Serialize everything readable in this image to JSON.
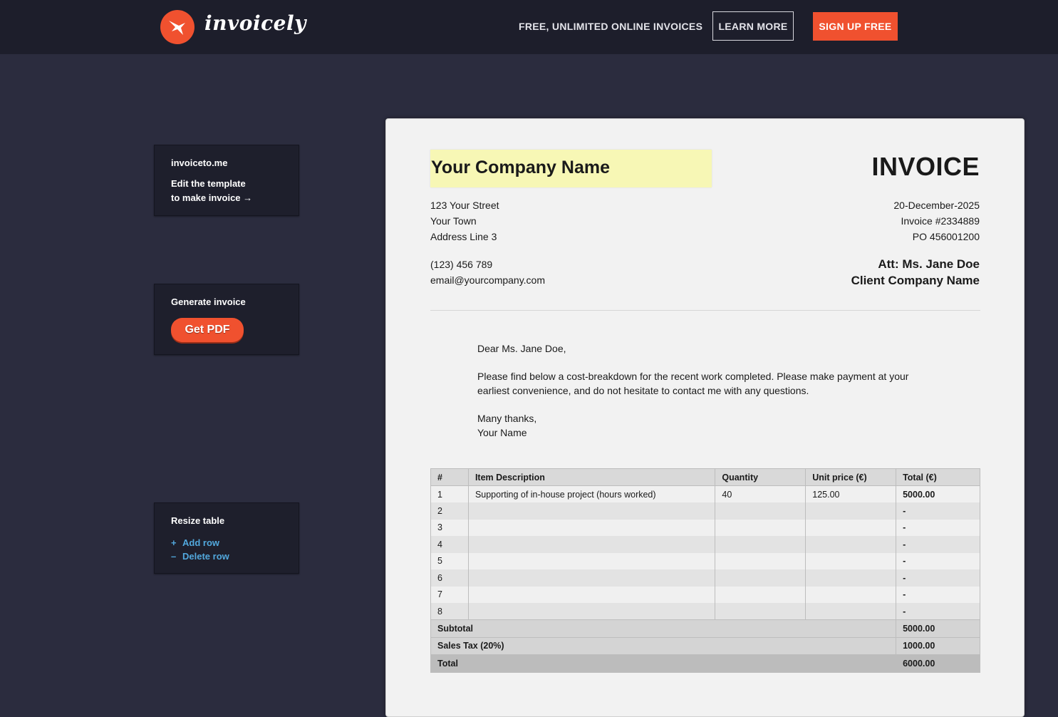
{
  "header": {
    "logo_text": "invoicely",
    "promo": "FREE, UNLIMITED ONLINE INVOICES",
    "learn_more": "LEARN MORE",
    "sign_up": "SIGN UP FREE",
    "accent_color": "#f0512f"
  },
  "sidebar": {
    "card1": {
      "brand": "invoiceto.me",
      "line1": "Edit the template",
      "line2": "to make invoice →"
    },
    "card2": {
      "title": "Generate invoice",
      "button": "Get PDF"
    },
    "card3": {
      "title": "Resize table",
      "add": "Add row",
      "add_sym": "+",
      "delete": "Delete row",
      "delete_sym": "–"
    }
  },
  "invoice": {
    "company_name": "Your Company Name",
    "title": "INVOICE",
    "address": [
      "123 Your Street",
      "Your Town",
      "Address Line 3"
    ],
    "phone": "(123) 456 789",
    "email": "email@yourcompany.com",
    "date": "20-December-2025",
    "number": "Invoice #2334889",
    "po": "PO 456001200",
    "attention": "Att: Ms. Jane Doe",
    "client": "Client Company Name",
    "letter": {
      "greeting": "Dear Ms. Jane Doe,",
      "body": "Please find below a cost-breakdown for the recent work completed. Please make payment at your earliest convenience, and do not hesitate to contact me with any questions.",
      "closing": "Many thanks,",
      "signature": "Your Name"
    },
    "table": {
      "headers": [
        "#",
        "Item Description",
        "Quantity",
        "Unit price (€)",
        "Total (€)"
      ],
      "rows": [
        [
          "1",
          "Supporting of in-house project (hours worked)",
          "40",
          "125.00",
          "5000.00"
        ],
        [
          "2",
          "",
          "",
          "",
          "-"
        ],
        [
          "3",
          "",
          "",
          "",
          "-"
        ],
        [
          "4",
          "",
          "",
          "",
          "-"
        ],
        [
          "5",
          "",
          "",
          "",
          "-"
        ],
        [
          "6",
          "",
          "",
          "",
          "-"
        ],
        [
          "7",
          "",
          "",
          "",
          "-"
        ],
        [
          "8",
          "",
          "",
          "",
          "-"
        ]
      ],
      "subtotal_label": "Subtotal",
      "subtotal": "5000.00",
      "tax_label": "Sales Tax (20%)",
      "tax": "1000.00",
      "total_label": "Total",
      "total": "6000.00"
    }
  }
}
